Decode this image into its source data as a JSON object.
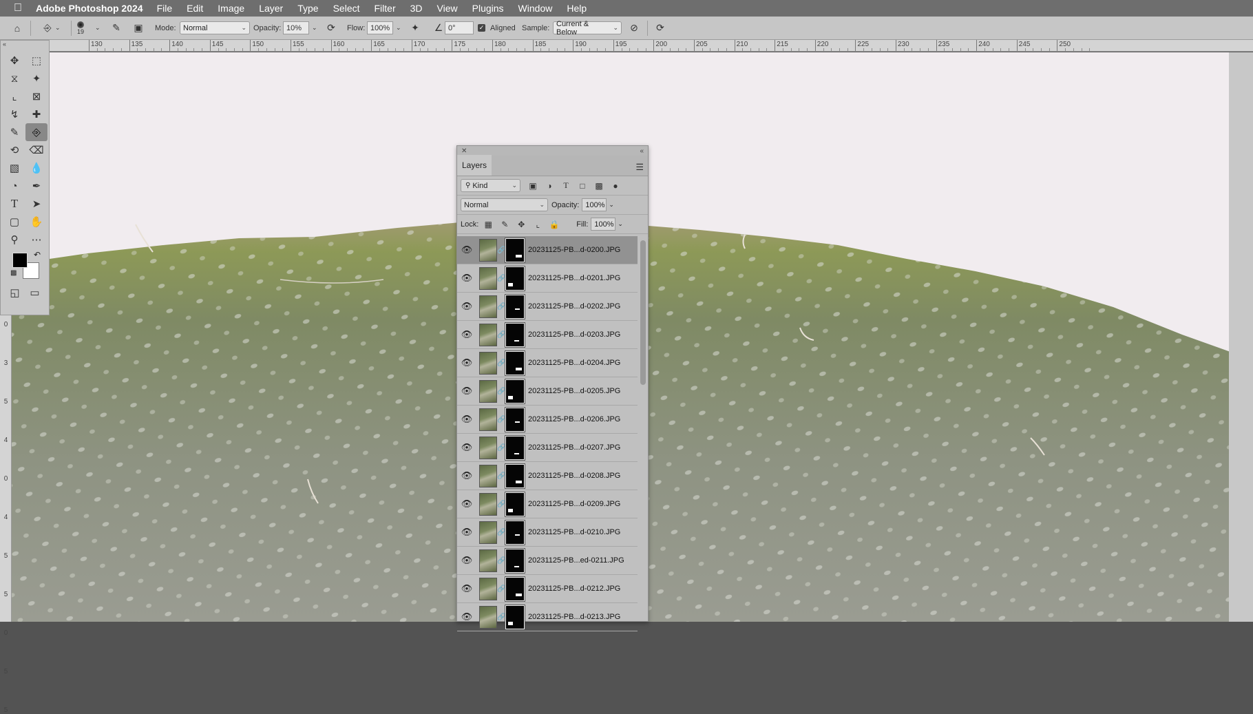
{
  "menubar": {
    "app_name": "Adobe Photoshop 2024",
    "items": [
      "File",
      "Edit",
      "Image",
      "Layer",
      "Type",
      "Select",
      "Filter",
      "3D",
      "View",
      "Plugins",
      "Window",
      "Help"
    ]
  },
  "options": {
    "brush_size": "19",
    "mode_label": "Mode:",
    "mode_value": "Normal",
    "opacity_label": "Opacity:",
    "opacity_value": "10%",
    "flow_label": "Flow:",
    "flow_value": "100%",
    "angle_value": "0°",
    "aligned_label": "Aligned",
    "aligned_checked": true,
    "sample_label": "Sample:",
    "sample_value": "Current & Below"
  },
  "ruler": {
    "top_labels": [
      "130",
      "135",
      "140",
      "145",
      "150",
      "155",
      "160",
      "165",
      "170",
      "175",
      "180",
      "185",
      "190",
      "195",
      "200",
      "205",
      "210",
      "215",
      "220",
      "225",
      "230",
      "235",
      "240",
      "245",
      "250"
    ],
    "left_labels": [
      "3",
      "0",
      "3",
      "5",
      "4",
      "0",
      "4",
      "5",
      "5",
      "0",
      "5",
      "5"
    ]
  },
  "layers_panel": {
    "tab_label": "Layers",
    "filter_kind": "Kind",
    "blend_mode": "Normal",
    "opacity_label": "Opacity:",
    "opacity_value": "100%",
    "lock_label": "Lock:",
    "fill_label": "Fill:",
    "fill_value": "100%",
    "layers": [
      {
        "name": "20231125-PB...d-0200.JPG",
        "selected": true
      },
      {
        "name": "20231125-PB...d-0201.JPG",
        "selected": false
      },
      {
        "name": "20231125-PB...d-0202.JPG",
        "selected": false
      },
      {
        "name": "20231125-PB...d-0203.JPG",
        "selected": false
      },
      {
        "name": "20231125-PB...d-0204.JPG",
        "selected": false
      },
      {
        "name": "20231125-PB...d-0205.JPG",
        "selected": false
      },
      {
        "name": "20231125-PB...d-0206.JPG",
        "selected": false
      },
      {
        "name": "20231125-PB...d-0207.JPG",
        "selected": false
      },
      {
        "name": "20231125-PB...d-0208.JPG",
        "selected": false
      },
      {
        "name": "20231125-PB...d-0209.JPG",
        "selected": false
      },
      {
        "name": "20231125-PB...d-0210.JPG",
        "selected": false
      },
      {
        "name": "20231125-PB...ed-0211.JPG",
        "selected": false
      },
      {
        "name": "20231125-PB...d-0212.JPG",
        "selected": false
      },
      {
        "name": "20231125-PB...d-0213.JPG",
        "selected": false
      }
    ]
  },
  "colors": {
    "foreground": "#000000",
    "background": "#ffffff"
  }
}
